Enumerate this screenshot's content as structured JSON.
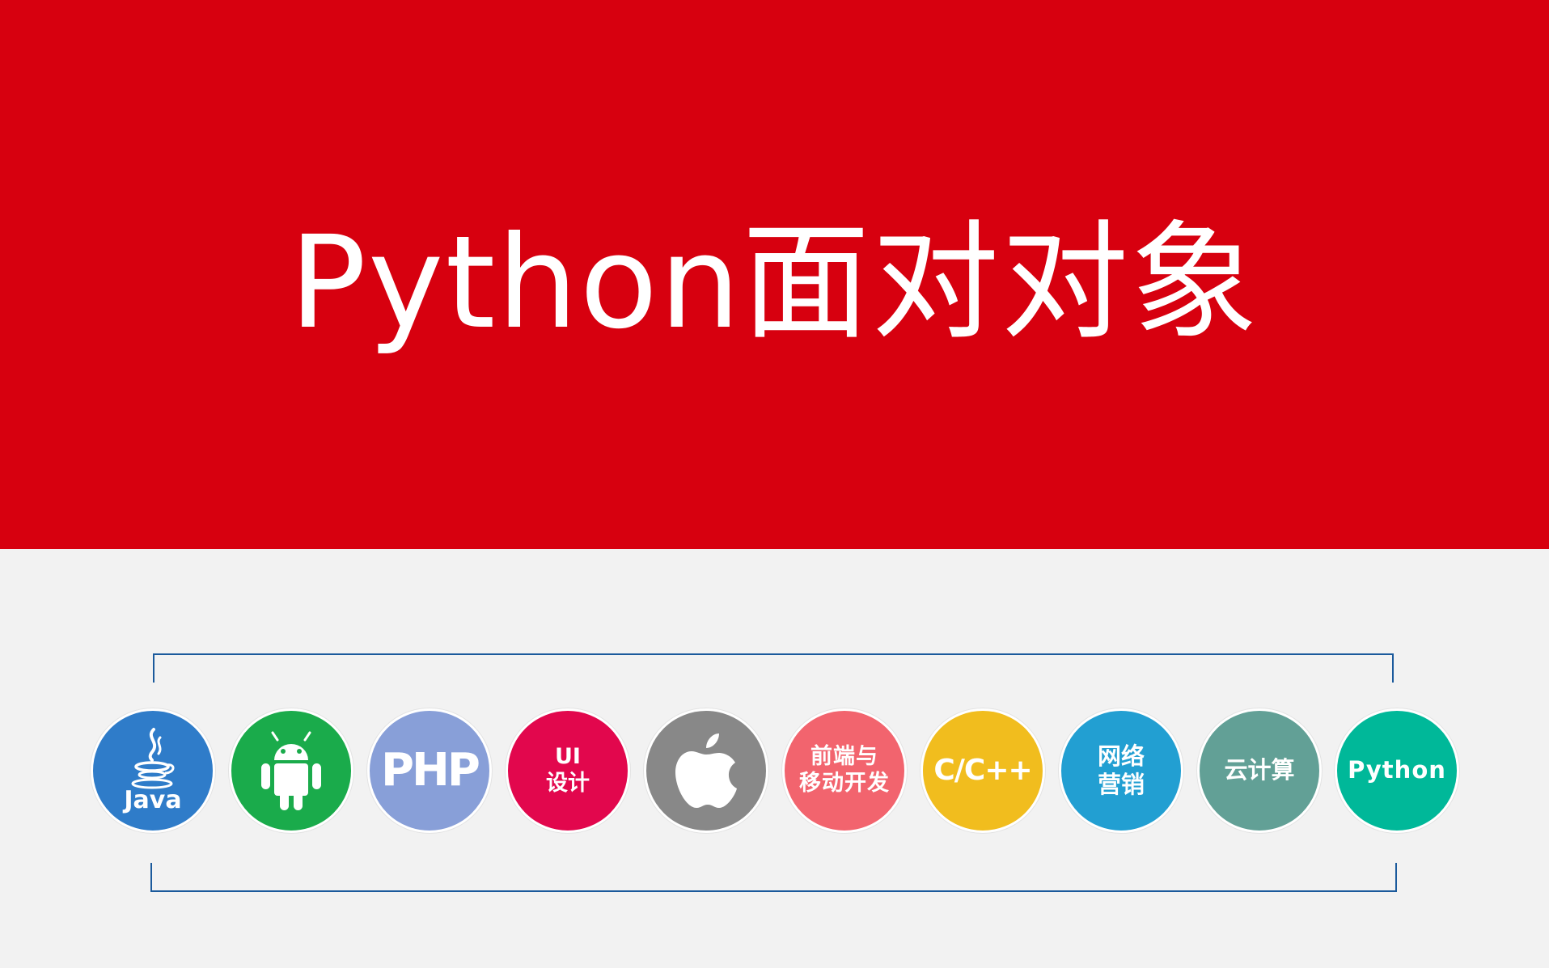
{
  "title": "Python面对对象",
  "colors": {
    "banner": "#d7000f",
    "background": "#f2f2f2",
    "bracket": "#1b5a9c"
  },
  "courses": [
    {
      "id": "java",
      "icon": "java-cup-icon",
      "label": "Java",
      "color": "#2f7cc9"
    },
    {
      "id": "android",
      "icon": "android-robot-icon",
      "label": "",
      "color": "#1aab4b"
    },
    {
      "id": "php",
      "icon": "",
      "label": "PHP",
      "color": "#889fd8"
    },
    {
      "id": "ui",
      "icon": "",
      "label": "UI\n设计",
      "color": "#e2074d"
    },
    {
      "id": "ios",
      "icon": "apple-icon",
      "label": "",
      "color": "#888888"
    },
    {
      "id": "web",
      "icon": "",
      "label": "前端与\n移动开发",
      "color": "#f2646e"
    },
    {
      "id": "c",
      "icon": "",
      "label": "C/C++",
      "color": "#f1bd1e"
    },
    {
      "id": "net",
      "icon": "",
      "label": "网络\n营销",
      "color": "#229fd2"
    },
    {
      "id": "cloud",
      "icon": "",
      "label": "云计算",
      "color": "#62a096"
    },
    {
      "id": "python",
      "icon": "",
      "label": "Python",
      "color": "#00b899"
    }
  ]
}
